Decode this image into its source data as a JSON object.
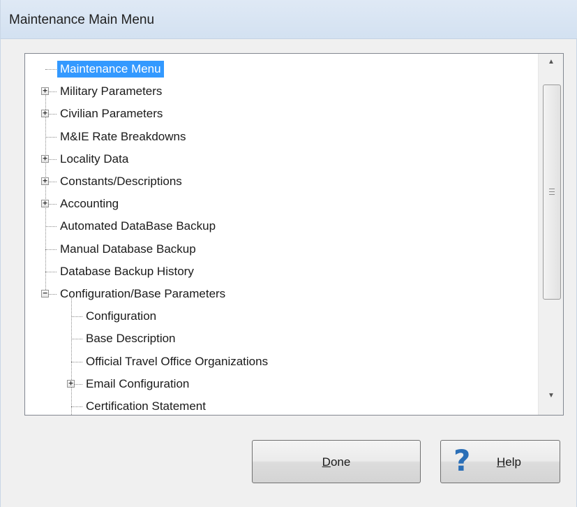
{
  "window": {
    "title": "Maintenance Main Menu"
  },
  "tree": {
    "items": [
      {
        "label": "Maintenance Menu",
        "level": 0,
        "expander": "none",
        "selected": true
      },
      {
        "label": "Military Parameters",
        "level": 0,
        "expander": "collapsed"
      },
      {
        "label": "Civilian Parameters",
        "level": 0,
        "expander": "collapsed"
      },
      {
        "label": "M&IE Rate Breakdowns",
        "level": 0,
        "expander": "none"
      },
      {
        "label": "Locality Data",
        "level": 0,
        "expander": "collapsed"
      },
      {
        "label": "Constants/Descriptions",
        "level": 0,
        "expander": "collapsed"
      },
      {
        "label": "Accounting",
        "level": 0,
        "expander": "collapsed"
      },
      {
        "label": "Automated DataBase Backup",
        "level": 0,
        "expander": "none"
      },
      {
        "label": "Manual Database Backup",
        "level": 0,
        "expander": "none"
      },
      {
        "label": "Database Backup History",
        "level": 0,
        "expander": "none"
      },
      {
        "label": "Configuration/Base Parameters",
        "level": 0,
        "expander": "expanded"
      },
      {
        "label": "Configuration",
        "level": 1,
        "expander": "none"
      },
      {
        "label": "Base Description",
        "level": 1,
        "expander": "none"
      },
      {
        "label": "Official Travel Office Organizations",
        "level": 1,
        "expander": "none"
      },
      {
        "label": "Email Configuration",
        "level": 1,
        "expander": "collapsed"
      },
      {
        "label": "Certification Statement",
        "level": 1,
        "expander": "none"
      }
    ]
  },
  "buttons": {
    "done": {
      "mnemonic": "D",
      "rest": "one"
    },
    "help": {
      "mnemonic": "H",
      "rest": "elp",
      "icon": "question-mark-icon"
    }
  },
  "colors": {
    "selection": "#3399ff",
    "help_icon": "#2b6fb7"
  }
}
